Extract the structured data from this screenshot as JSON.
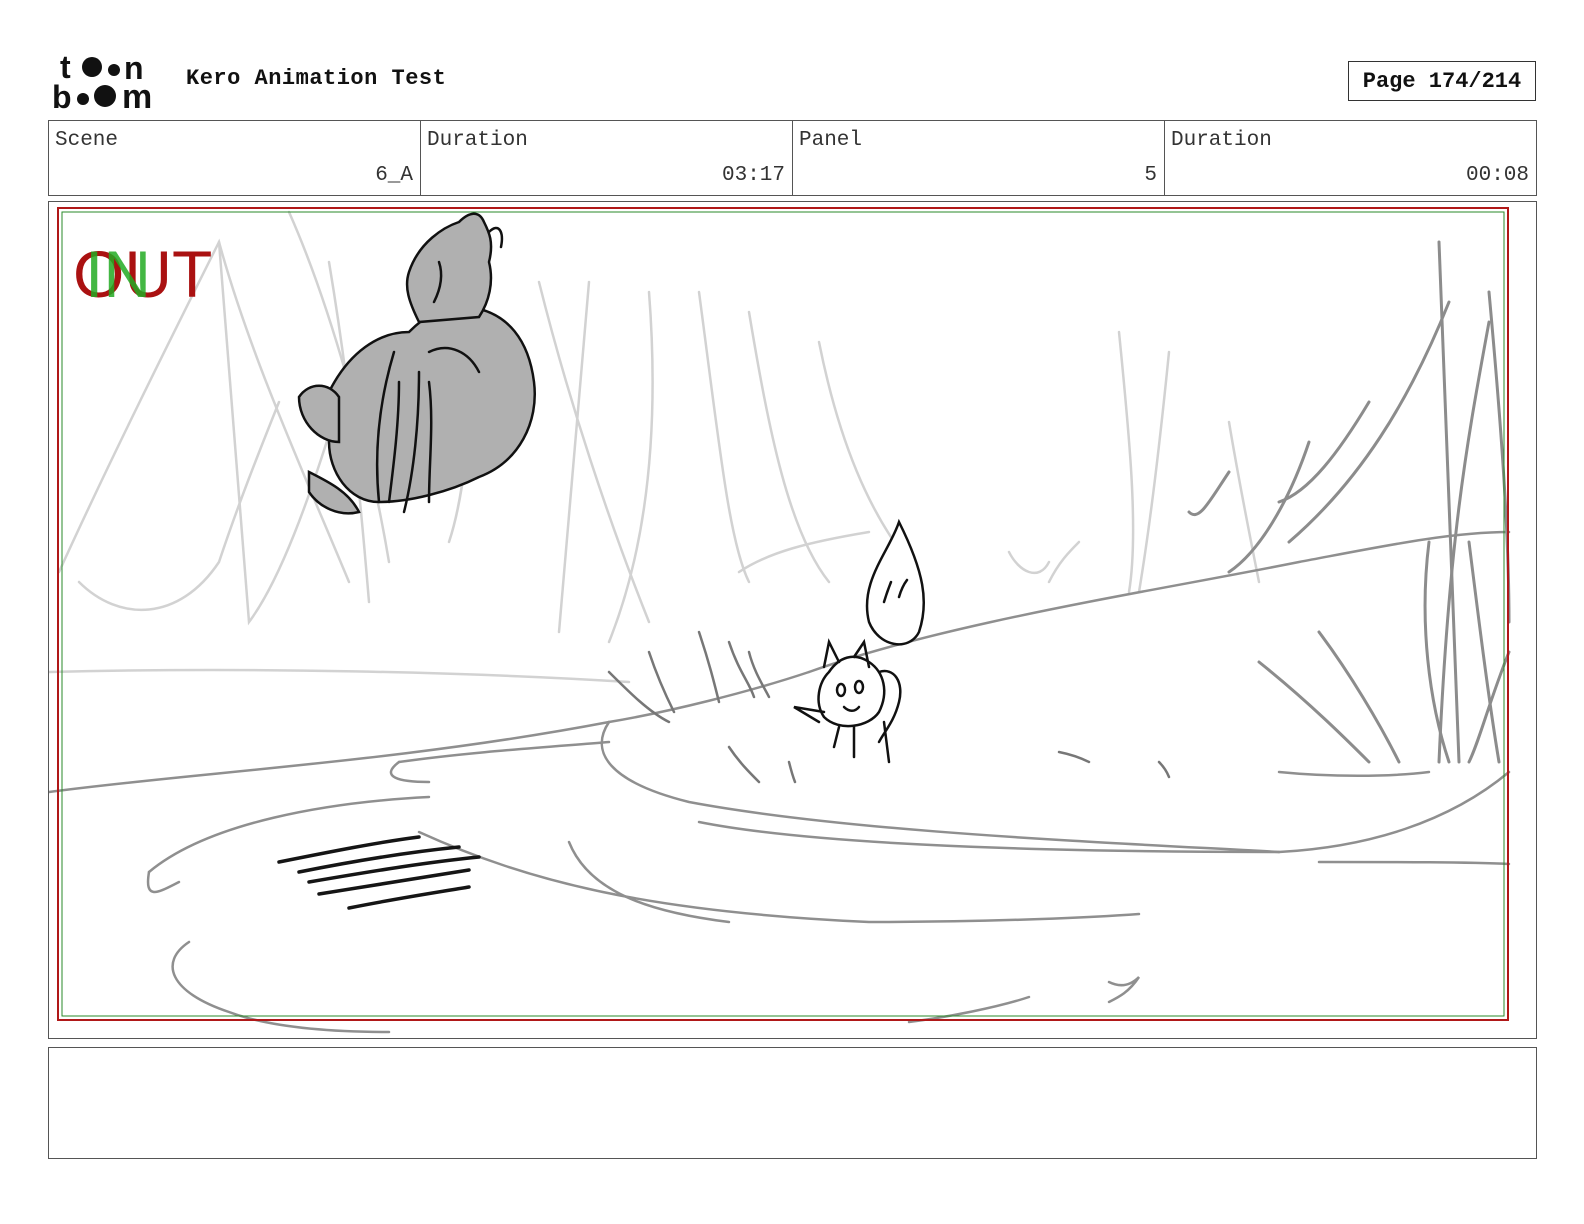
{
  "header": {
    "logo_text": "toon boom",
    "project_title": "Kero Animation Test",
    "page_label": "Page 174/214"
  },
  "info": {
    "scene_label": "Scene",
    "scene_value": "6_A",
    "scene_duration_label": "Duration",
    "scene_duration_value": "03:17",
    "panel_label": "Panel",
    "panel_value": "5",
    "panel_duration_label": "Duration",
    "panel_duration_value": "00:08"
  },
  "panel": {
    "in_marker": "IN",
    "out_marker": "OUT",
    "colors": {
      "safe_frame": "#b01818",
      "in_marker": "#22aa22",
      "out_marker": "#aa1111"
    }
  },
  "notes": {
    "text": ""
  }
}
